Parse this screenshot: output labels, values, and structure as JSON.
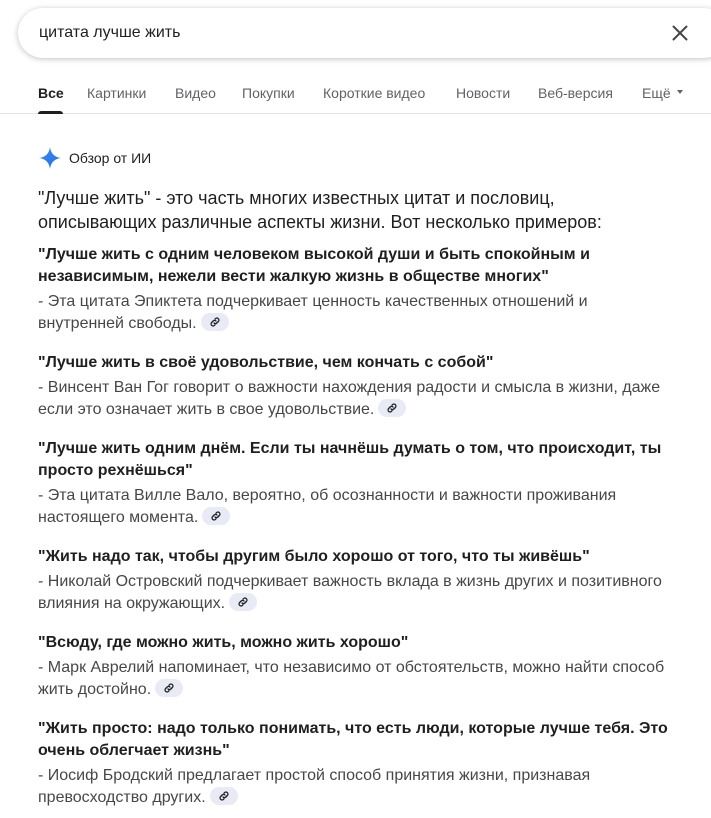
{
  "search": {
    "query": "цитата лучше жить"
  },
  "tabs": [
    {
      "label": "Все"
    },
    {
      "label": "Картинки"
    },
    {
      "label": "Видео"
    },
    {
      "label": "Покупки"
    },
    {
      "label": "Короткие видео"
    },
    {
      "label": "Новости"
    },
    {
      "label": "Веб-версия"
    },
    {
      "label": "Ещё"
    }
  ],
  "ai_overview": {
    "title": "Обзор от ИИ",
    "intro": "\"Лучше жить\" - это часть многих известных цитат и пословиц, описывающих различные аспекты жизни. Вот несколько примеров:",
    "quotes": [
      {
        "title": "\"Лучше жить с одним человеком высокой души и быть спокойным и независимым, нежели вести жалкую жизнь в обществе многих\"",
        "desc": "- Эта цитата Эпиктета подчеркивает ценность качественных отношений и внутренней свободы."
      },
      {
        "title": "\"Лучше жить в своё удовольствие, чем кончать с собой\"",
        "desc": "- Винсент Ван Гог говорит о важности нахождения радости и смысла в жизни, даже если это означает жить в свое удовольствие."
      },
      {
        "title": "\"Лучше жить одним днём. Если ты начнёшь думать о том, что происходит, ты просто рехнёшься\"",
        "desc": "- Эта цитата Вилле Вало, вероятно, об осознанности и важности проживания настоящего момента."
      },
      {
        "title": "\"Жить надо так, чтобы другим было хорошо от того, что ты живёшь\"",
        "desc": "- Николай Островский подчеркивает важность вклада в жизнь других и позитивного влияния на окружающих."
      },
      {
        "title": "\"Всюду, где можно жить, можно жить хорошо\"",
        "desc": "- Марк Аврелий напоминает, что независимо от обстоятельств, можно найти способ жить достойно."
      },
      {
        "title": "\"Жить просто: надо только понимать, что есть люди, которые лучше тебя. Это очень облегчает жизнь\"",
        "desc": "- Иосиф Бродский предлагает простой способ принятия жизни, признавая превосходство других."
      }
    ]
  },
  "icons": {
    "clear": "close-icon",
    "ai": "sparkle-icon",
    "link": "link-icon"
  },
  "colors": {
    "ai_sparkle": "#4285f4",
    "chip_bg": "#e8eaf6"
  }
}
